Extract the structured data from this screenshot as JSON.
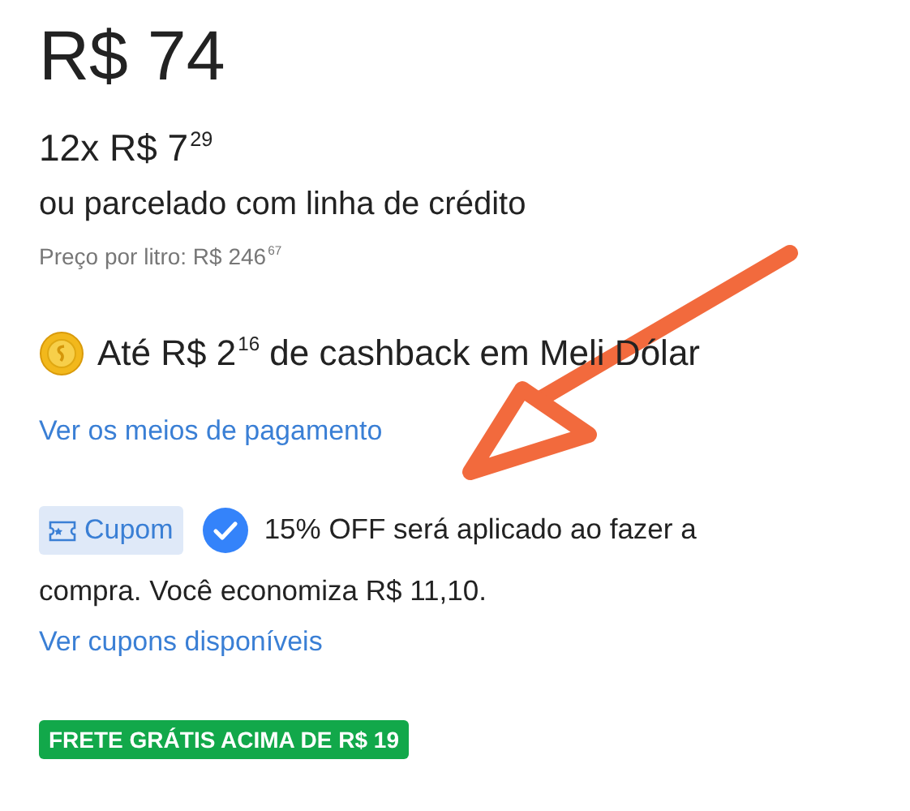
{
  "price": "R$ 74",
  "installments": "12x R$ 7$^{29}$",
  "credit_line": "ou parcelado com linha de crédito",
  "price_per_liter": "Preço por litro: R$ 246$^{67}$",
  "cashback": "Até R$ 2$^{16}$ de cashback em Meli Dólar",
  "payment_link": "Ver os meios de pagamento",
  "coupon": {
    "tag": "Cupom",
    "applied": true,
    "lines": [
      "15% OFF será aplicado ao fazer a",
      "compra. Você economiza R$ 11,10."
    ]
  },
  "coupons_link": "Ver cupons disponíveis",
  "shipping_badge": "FRETE GRÁTIS ACIMA DE R$ 19"
}
